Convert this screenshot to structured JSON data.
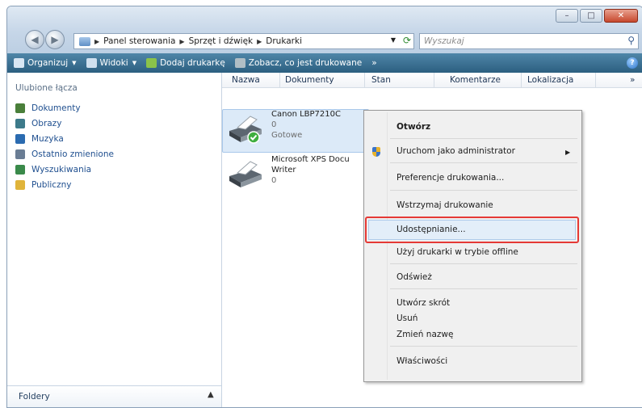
{
  "window": {
    "controls": {
      "minimize": "–",
      "maximize": "□",
      "close": "✕"
    }
  },
  "address_bar": {
    "crumbs": [
      "Panel sterowania",
      "Sprzęt i dźwięk",
      "Drukarki"
    ]
  },
  "search": {
    "placeholder": "Wyszukaj"
  },
  "toolbar": {
    "organize": "Organizuj",
    "views": "Widoki",
    "add_printer": "Dodaj drukarkę",
    "see_printing": "Zobacz, co jest drukowane",
    "more": "»"
  },
  "sidebar": {
    "title": "Ulubione łącza",
    "items": [
      {
        "label": "Dokumenty",
        "icon": "documents-icon",
        "color": "#4a7f3a"
      },
      {
        "label": "Obrazy",
        "icon": "pictures-icon",
        "color": "#3d7a8a"
      },
      {
        "label": "Muzyka",
        "icon": "music-icon",
        "color": "#2b6bb0"
      },
      {
        "label": "Ostatnio zmienione",
        "icon": "recent-icon",
        "color": "#6a7d94"
      },
      {
        "label": "Wyszukiwania",
        "icon": "searches-icon",
        "color": "#3a8a4a"
      },
      {
        "label": "Publiczny",
        "icon": "public-folder-icon",
        "color": "#e0b43a"
      }
    ],
    "footer": "Foldery"
  },
  "columns": [
    "Nazwa",
    "Dokumenty",
    "Stan",
    "Komentarze",
    "Lokalizacja",
    "»"
  ],
  "printers": [
    {
      "name": "Canon LBP7210C",
      "docs": "0",
      "status": "Gotowe"
    },
    {
      "name": "Microsoft XPS Docu",
      "name2": "Writer",
      "docs": "0"
    }
  ],
  "context_menu": {
    "open": "Otwórz",
    "run_as_admin": "Uruchom jako administrator",
    "printing_prefs": "Preferencje drukowania...",
    "pause_printing": "Wstrzymaj drukowanie",
    "sharing": "Udostępnianie...",
    "use_offline": "Użyj drukarki w trybie offline",
    "refresh": "Odśwież",
    "create_shortcut": "Utwórz skrót",
    "delete": "Usuń",
    "rename": "Zmień nazwę",
    "properties": "Właściwości"
  },
  "colors": {
    "toolbar": "#2c5f80",
    "link": "#1f4f8f",
    "highlight_border": "#e53935"
  }
}
